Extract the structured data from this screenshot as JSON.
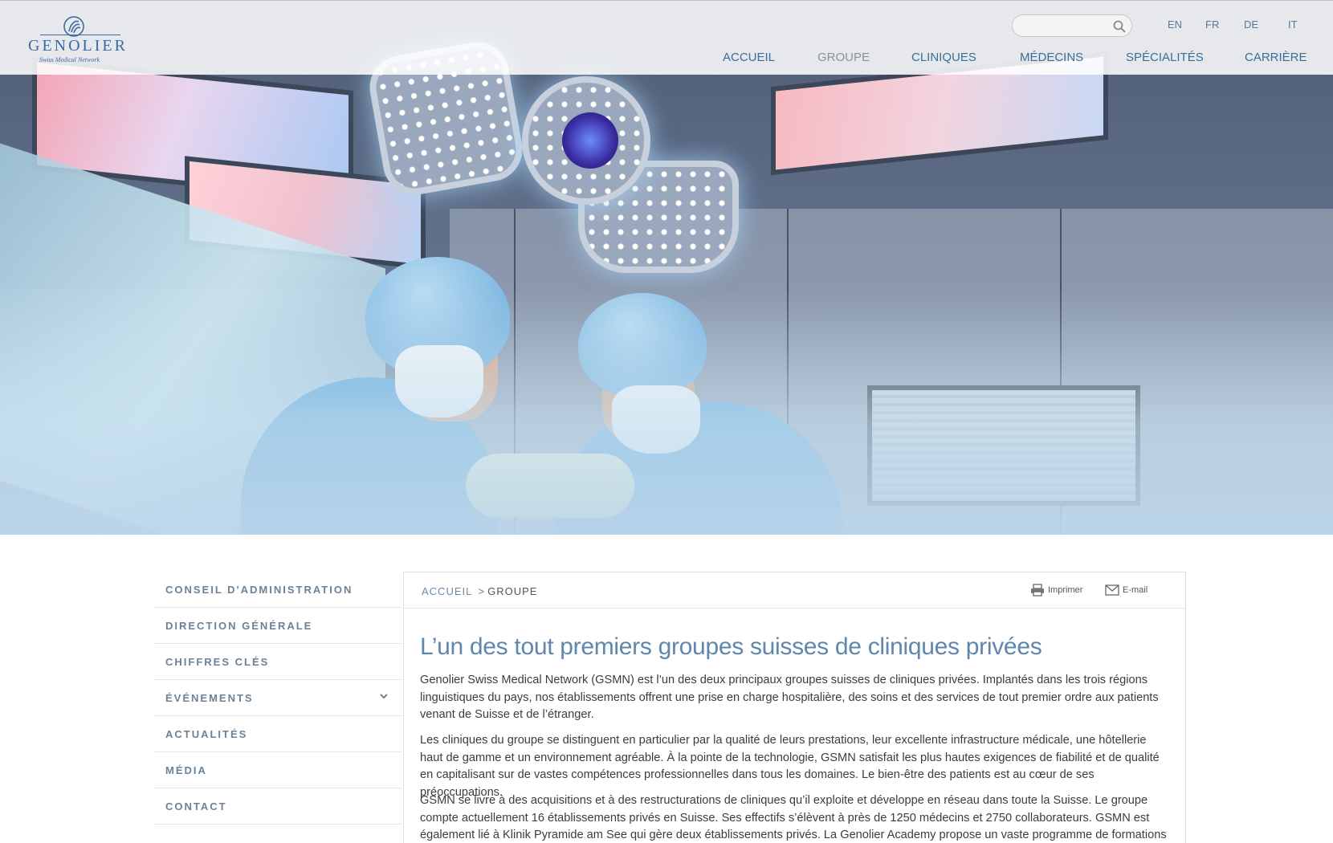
{
  "brand": {
    "name": "GENOLIER",
    "tagline": "Swiss Medical Network"
  },
  "search": {
    "placeholder": "",
    "value": ""
  },
  "languages": [
    "EN",
    "FR",
    "DE",
    "IT"
  ],
  "nav": {
    "items": [
      {
        "label": "ACCUEIL"
      },
      {
        "label": "GROUPE"
      },
      {
        "label": "CLINIQUES"
      },
      {
        "label": "MÉDECINS"
      },
      {
        "label": "SPÉCIALITÉS"
      },
      {
        "label": "CARRIÈRE"
      }
    ],
    "active": "GROUPE"
  },
  "sidebar": {
    "items": [
      {
        "label": "CONSEIL D'ADMINISTRATION"
      },
      {
        "label": "DIRECTION GÉNÉRALE"
      },
      {
        "label": "CHIFFRES CLÉS"
      },
      {
        "label": "ÉVÉNEMENTS"
      },
      {
        "label": "ACTUALITÉS"
      },
      {
        "label": "MÉDIA"
      },
      {
        "label": "CONTACT"
      }
    ]
  },
  "breadcrumb": {
    "home": "ACCUEIL",
    "separator": ">",
    "current": "GROUPE"
  },
  "tools": {
    "print_label": "Imprimer",
    "email_label": "E-mail"
  },
  "content": {
    "title": "L’un des tout premiers groupes suisses de cliniques privées",
    "paragraphs": [
      "Genolier Swiss Medical Network (GSMN) est l’un des deux principaux groupes suisses de cliniques privées. Implantés dans les trois régions linguistiques du pays, nos établissements offrent une prise en charge hospitalière, des soins et des services de tout premier ordre aux patients venant de Suisse et de l’étranger.",
      "Les cliniques du groupe se distinguent en particulier par la qualité de leurs prestations, leur excellente infrastructure médicale, une hôtellerie haut de gamme et un environnement agréable. À la pointe de la technologie, GSMN satisfait les plus hautes exigences de fiabilité et de qualité en capitalisant sur de vastes compétences professionnelles dans tous les domaines. Le bien-être des patients est au cœur de ses préoccupations.",
      "GSMN se livre à des acquisitions et à des restructurations de cliniques qu’il exploite et développe en réseau dans toute la Suisse. Le groupe compte actuellement 16 établissements privés en Suisse. Ses effectifs s’élèvent à près de 1250 médecins et 2750 collaborateurs. GSMN est également lié à Klinik Pyramide am See qui gère deux établissements privés. La Genolier Academy propose un vaste programme de formations"
    ]
  },
  "icons": {
    "search": "search-icon",
    "print": "printer-icon",
    "email": "envelope-icon",
    "chevron": "chevron-down-icon"
  },
  "colors": {
    "brand_blue": "#3a6aa3",
    "nav_link": "#3a6d9a",
    "title_blue": "#5f86ad",
    "sidebar_text": "#6b8296"
  }
}
